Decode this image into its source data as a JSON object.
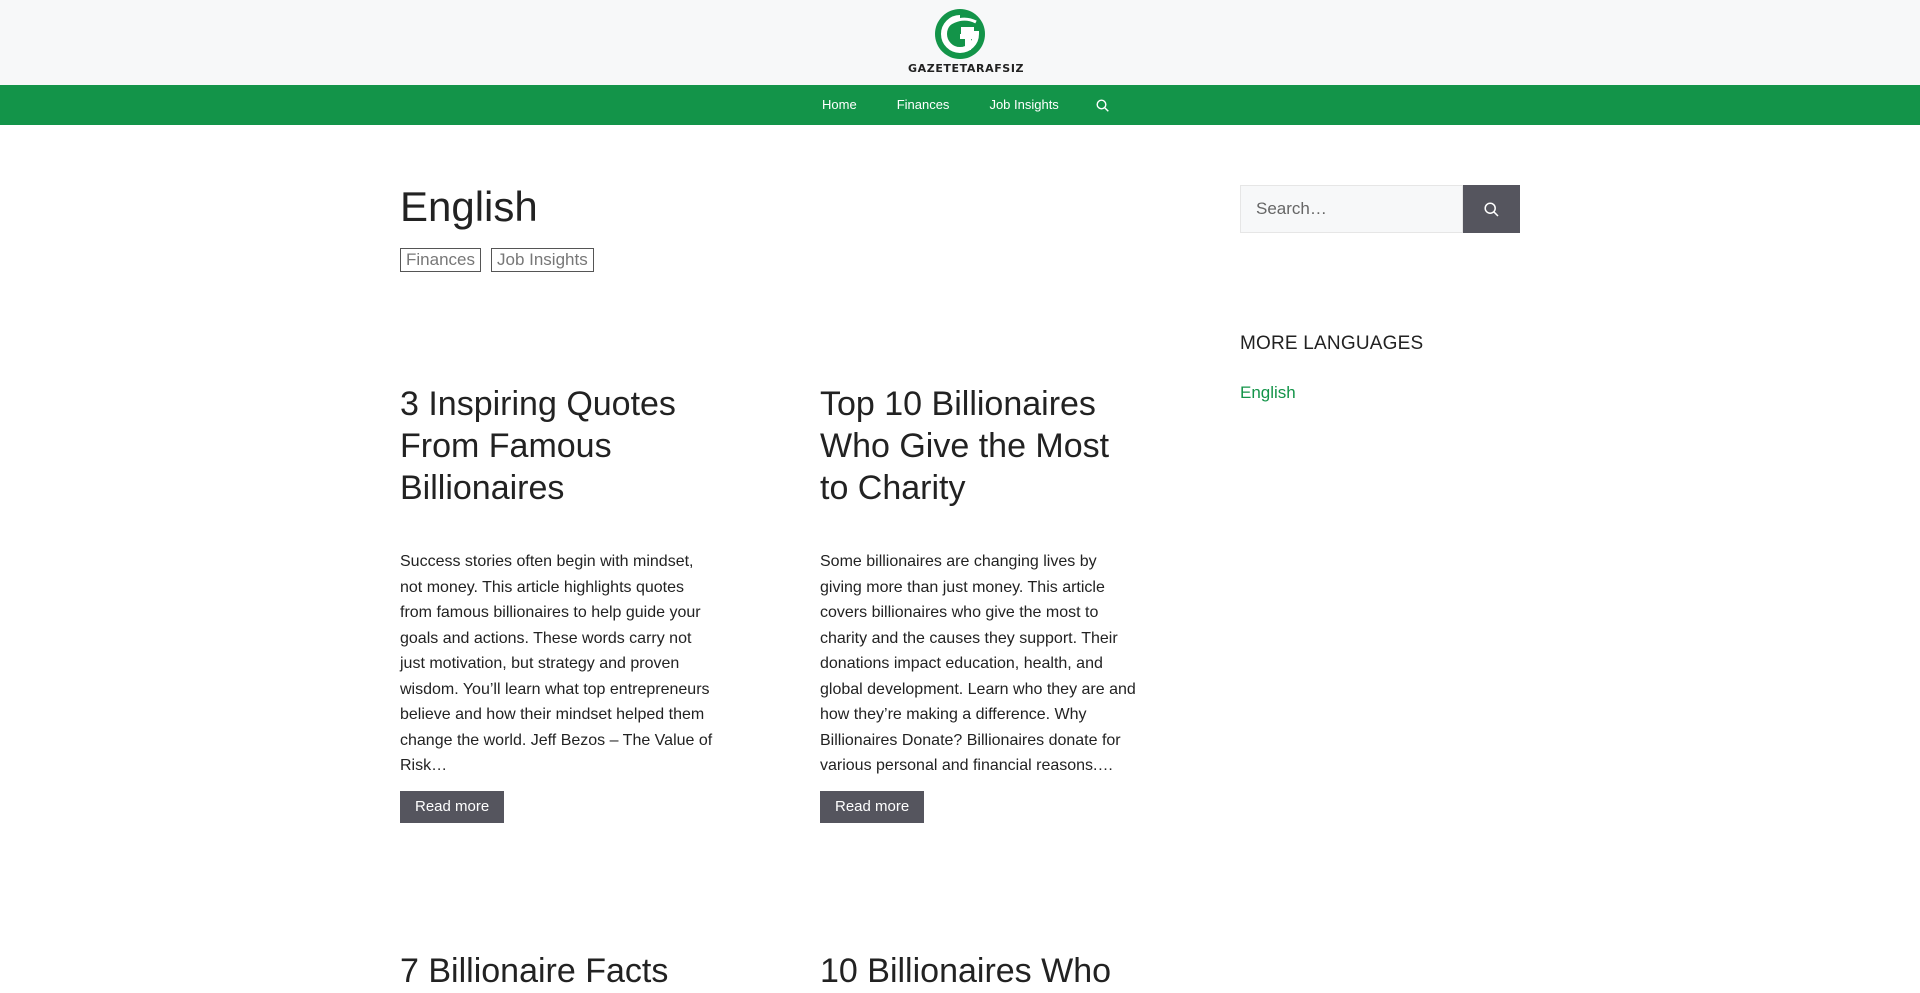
{
  "header": {
    "logo_text": "GAZETETARAFSIZ",
    "brand_color": "#139449"
  },
  "nav": {
    "items": [
      {
        "label": "Home"
      },
      {
        "label": "Finances"
      },
      {
        "label": "Job Insights"
      }
    ],
    "search_icon": "search-icon"
  },
  "page": {
    "title": "English",
    "tags": [
      "Finances",
      "Job Insights"
    ]
  },
  "posts": [
    {
      "title": "3 Inspiring Quotes From Famous Billionaires",
      "excerpt": "Success stories often begin with mindset, not money. This article highlights quotes from famous billionaires to help guide your goals and actions.  These words carry not just motivation, but strategy and proven wisdom. You’ll learn what top entrepreneurs believe and how their mindset helped them change the world. Jeff Bezos – The Value of Risk…",
      "read_more": "Read more"
    },
    {
      "title": "Top 10 Billionaires Who Give the Most to Charity",
      "excerpt": "Some billionaires are changing lives by giving more than just money. This article covers billionaires who give the most to charity and the causes they support.  Their donations impact education, health, and global development. Learn who they are and how they’re making a difference. Why Billionaires Donate? Billionaires donate for various personal and financial reasons.…",
      "read_more": "Read more"
    },
    {
      "title": "7 Billionaire Facts"
    },
    {
      "title": "10 Billionaires Who"
    }
  ],
  "sidebar": {
    "search_placeholder": "Search…",
    "widget_title": "MORE LANGUAGES",
    "languages": [
      "English"
    ]
  }
}
